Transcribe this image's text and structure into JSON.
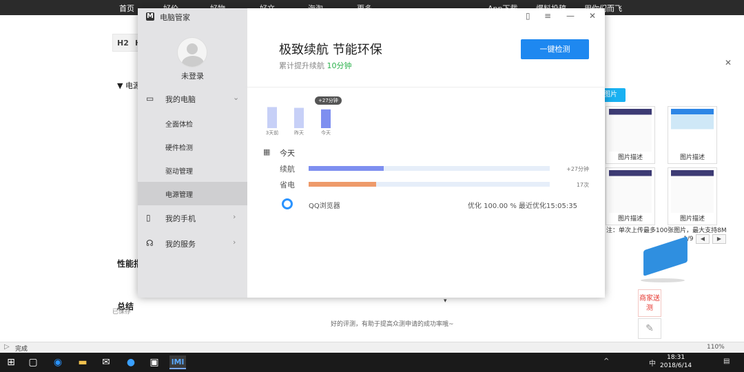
{
  "browser": {
    "nav": [
      "首页",
      "好价",
      "好物",
      "好文",
      "海淘",
      "更多",
      "App下载",
      "爆料投稿",
      "用你们而飞"
    ],
    "editor_toolbar": [
      "H2",
      "H"
    ],
    "outline_item": "▼ 电源",
    "section_performance": "性能指",
    "section_summary": "总结",
    "saved": "已保存",
    "hint": "好的评测，有助于提高众测申请的成功率哦~",
    "upload": {
      "button": "图片",
      "captions": [
        "图片描述",
        "图片描述",
        "图片描述",
        "图片描述"
      ],
      "note": "注：单次上传最多100张图片，最大支持8M",
      "page": "1/9"
    },
    "merchant_label": "商家送测",
    "status": "完成",
    "zoom": "110%"
  },
  "taskbar": {
    "time": "18:31",
    "date": "2018/6/14",
    "ime": "中"
  },
  "app": {
    "title": "电脑管家",
    "login": "未登录",
    "menu": {
      "my_pc": "我的电脑",
      "full_check": "全面体检",
      "hardware": "硬件检测",
      "drivers": "驱动管理",
      "power": "电源管理",
      "my_phone": "我的手机",
      "my_service": "我的服务"
    },
    "headline": "极致续航 节能环保",
    "subline_prefix": "累计提升续航",
    "subline_value": "10分钟",
    "cta": "一键检测",
    "today": "今天",
    "rows": [
      {
        "label": "续航",
        "value": "+27分钟",
        "fraction": 0.31,
        "color": "#7e8ff0"
      },
      {
        "label": "省电",
        "value": "17次",
        "fraction": 0.28,
        "color": "#ee9a6a"
      }
    ],
    "process": {
      "name": "QQ浏览器",
      "optimization": "优化 100.00 %",
      "last_prefix": "最近优化",
      "last_time": "15:05:35"
    }
  },
  "chart_data": {
    "type": "bar",
    "categories": [
      "3天前",
      "昨天",
      "今天"
    ],
    "values": [
      27,
      26,
      24
    ],
    "tooltip": "+27分钟",
    "title": "",
    "xlabel": "",
    "ylabel": ""
  }
}
